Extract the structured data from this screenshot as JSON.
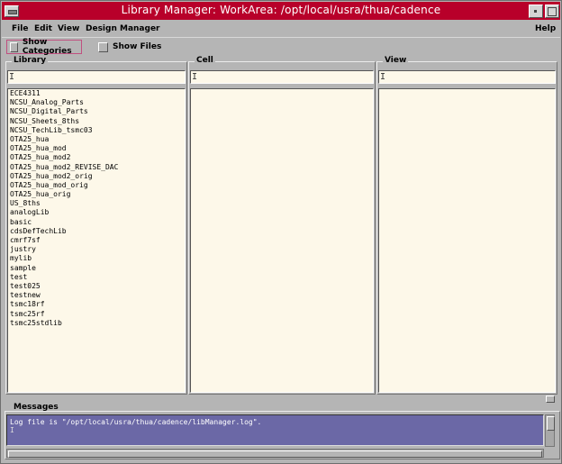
{
  "window": {
    "title": "Library Manager: WorkArea: /opt/local/usra/thua/cadence"
  },
  "menubar": {
    "file": "File",
    "edit": "Edit",
    "view": "View",
    "design_manager": "Design Manager",
    "help": "Help"
  },
  "toggles": {
    "show_categories": "Show Categories",
    "show_files": "Show Files"
  },
  "panels": {
    "library": {
      "label": "Library",
      "filter_value": "",
      "items": [
        "ECE4311",
        "NCSU_Analog_Parts",
        "NCSU_Digital_Parts",
        "NCSU_Sheets_8ths",
        "NCSU_TechLib_tsmc03",
        "OTA25_hua",
        "OTA25_hua_mod",
        "OTA25_hua_mod2",
        "OTA25_hua_mod2_REVISE_DAC",
        "OTA25_hua_mod2_orig",
        "OTA25_hua_mod_orig",
        "OTA25_hua_orig",
        "US_8ths",
        "analogLib",
        "basic",
        "cdsDefTechLib",
        "cmrf7sf",
        "justry",
        "mylib",
        "sample",
        "test",
        "test025",
        "testnew",
        "tsmc18rf",
        "tsmc25rf",
        "tsmc25stdlib"
      ]
    },
    "cell": {
      "label": "Cell",
      "filter_value": ""
    },
    "view": {
      "label": "View",
      "filter_value": ""
    }
  },
  "messages": {
    "label": "Messages",
    "log": "Log file is \"/opt/local/usra/thua/cadence/libManager.log\"."
  },
  "colors": {
    "titlebar": "#b8002a",
    "list_background": "#fdf8e9",
    "messages_background": "#6b68a6",
    "window_background": "#b5b5b5"
  }
}
